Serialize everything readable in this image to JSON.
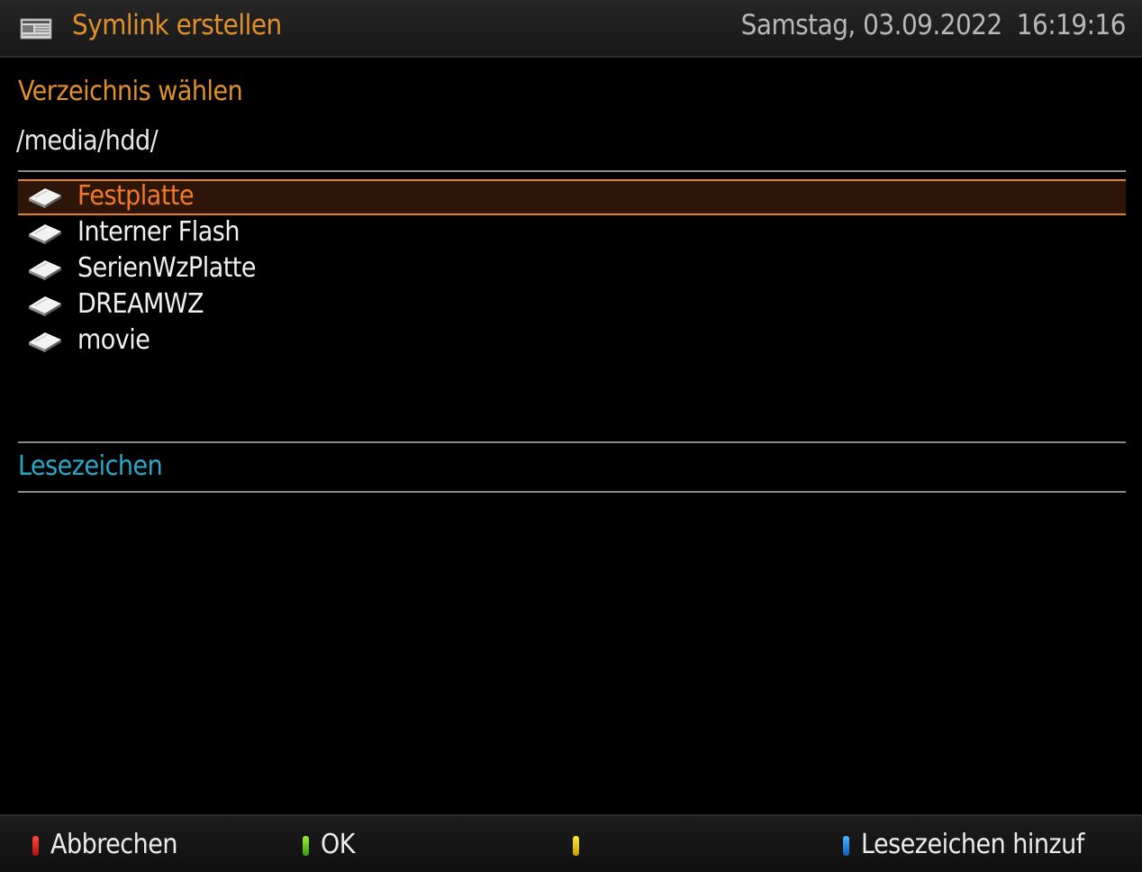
{
  "header": {
    "title": "Symlink erstellen",
    "date": "Samstag, 03.09.2022",
    "time": "16:19:16",
    "icon": "news-icon"
  },
  "main": {
    "section_title": "Verzeichnis wählen",
    "current_path": "/media/hdd/",
    "directories": [
      {
        "label": "Festplatte",
        "icon": "harddisk-icon",
        "selected": true
      },
      {
        "label": "Interner Flash",
        "icon": "harddisk-icon",
        "selected": false
      },
      {
        "label": "SerienWzPlatte",
        "icon": "harddisk-icon",
        "selected": false
      },
      {
        "label": "DREAMWZ",
        "icon": "harddisk-icon",
        "selected": false
      },
      {
        "label": "movie",
        "icon": "harddisk-icon",
        "selected": false
      }
    ],
    "bookmarks_title": "Lesezeichen",
    "bookmarks": []
  },
  "footer": {
    "red_label": "Abbrechen",
    "green_label": "OK",
    "yellow_label": "",
    "blue_label": "Lesezeichen hinzuf"
  },
  "colors": {
    "accent": "#e0902a",
    "selection": "#f07a2a",
    "bookmarks": "#2aa8c8",
    "red": "#e02020",
    "green": "#6cd020",
    "yellow": "#f0d010",
    "blue": "#2090f0"
  }
}
